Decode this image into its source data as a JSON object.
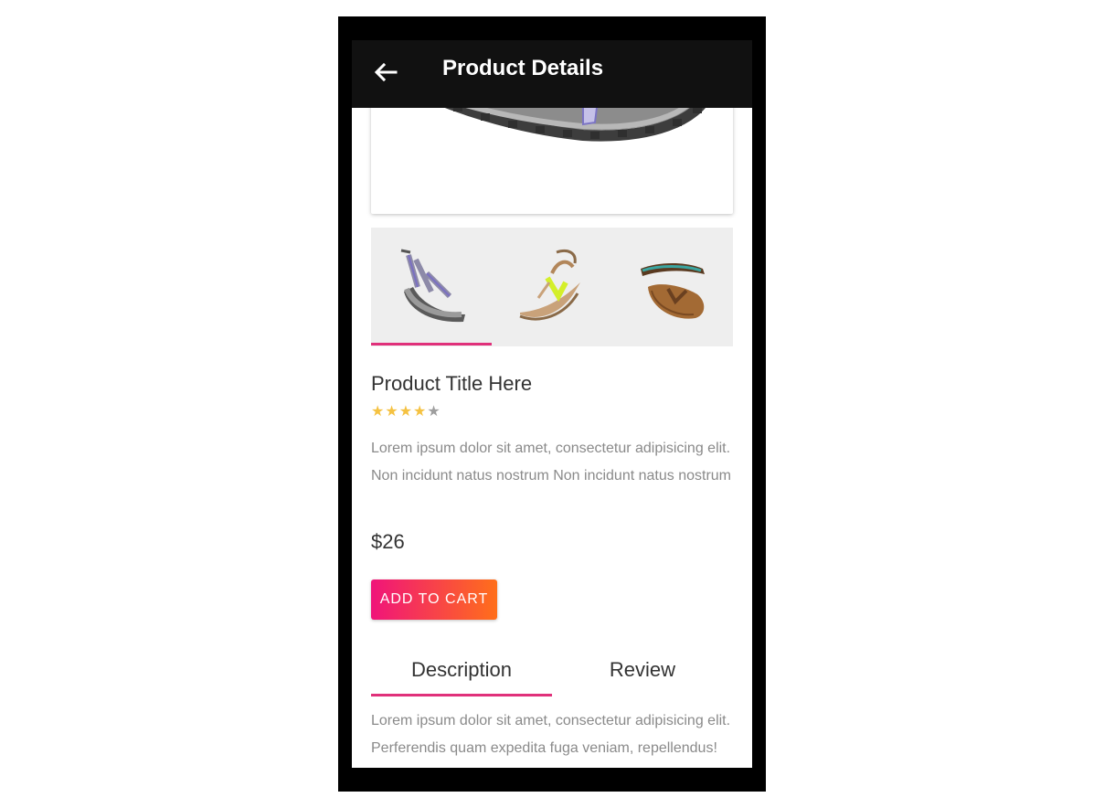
{
  "app_bar": {
    "title": "Product Details",
    "back_icon": "arrow-left-icon"
  },
  "product": {
    "title": "Product Title Here",
    "rating": {
      "value": 4,
      "max": 5,
      "filled_color": "#f5c242",
      "empty_color": "#9e9e9e"
    },
    "description": "Lorem ipsum dolor sit amet, consectetur adipisicing elit. Non incidunt natus nostrum Non incidunt natus nostrum",
    "price": "$26",
    "add_to_cart_label": "ADD TO CART"
  },
  "thumbnails": [
    {
      "name": "grey-sport-sandal",
      "selected": true
    },
    {
      "name": "strappy-yellow-sandal",
      "selected": false
    },
    {
      "name": "brown-flip-flop",
      "selected": false
    }
  ],
  "tabs": [
    {
      "label": "Description",
      "active": true
    },
    {
      "label": "Review",
      "active": false
    }
  ],
  "tab_content": "Lorem ipsum dolor sit amet, consectetur adipisicing elit. Perferendis quam expedita fuga veniam, repellendus!",
  "colors": {
    "accent": "#e0307a",
    "app_bar": "#111111",
    "button_gradient_start": "#f0147a",
    "button_gradient_end": "#ff6f1a"
  }
}
